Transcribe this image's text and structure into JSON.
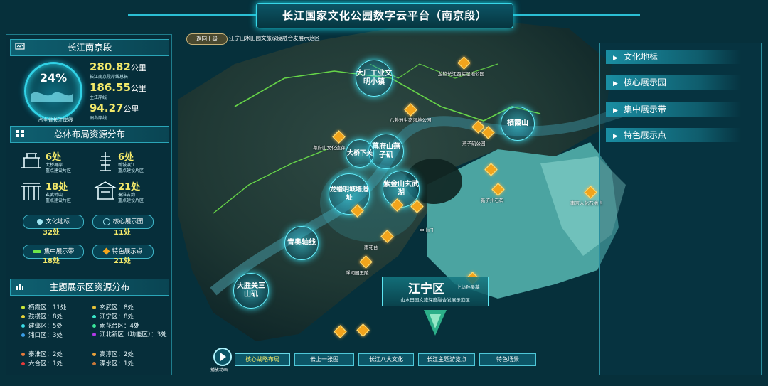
{
  "header": {
    "title": "长江国家文化公园数字云平台（南京段）"
  },
  "breadcrumb": {
    "back_label": "返回上级",
    "path": "江宁山水田园文旅深度融合发展示范区"
  },
  "left_panel": {
    "section1": {
      "title": "长江南京段",
      "ring_percent": "24%",
      "ring_caption": "占全省长江岸线",
      "stats": [
        {
          "value": "280.82",
          "unit": "公里",
          "desc": "长江南京段岸线总长"
        },
        {
          "value": "186.55",
          "unit": "公里",
          "desc": "主江岸线"
        },
        {
          "value": "94.27",
          "unit": "公里",
          "desc": "洲岛岸线"
        }
      ]
    },
    "section2": {
      "title": "总体布局资源分布",
      "items": [
        {
          "value": "6处",
          "desc1": "大桥再岸",
          "desc2": "重点建设片区"
        },
        {
          "value": "6处",
          "desc1": "新城滨江",
          "desc2": "重点建设片区"
        },
        {
          "value": "18处",
          "desc1": "玄武钟山",
          "desc2": "重点建设片区"
        },
        {
          "value": "21处",
          "desc1": "秦淮古韵",
          "desc2": "重点建设片区"
        }
      ],
      "pills": [
        {
          "label": "文化地标",
          "value": "32处"
        },
        {
          "label": "核心展示园",
          "value": "11处"
        },
        {
          "label": "集中展示带",
          "value": "18处"
        },
        {
          "label": "特色展示点",
          "value": "21处"
        }
      ]
    },
    "section3": {
      "title": "主题展示区资源分布",
      "legend_left": [
        {
          "label": "栖霞区：11处",
          "color": "#c9e63a"
        },
        {
          "label": "鼓楼区：8处",
          "color": "#e6d23a"
        },
        {
          "label": "建邺区：5处",
          "color": "#3adbe6"
        },
        {
          "label": "浦口区：3处",
          "color": "#3a9de6"
        },
        {
          "label": "秦淮区：2处",
          "color": "#e67a3a"
        },
        {
          "label": "六合区：1处",
          "color": "#e63a3a"
        }
      ],
      "legend_right": [
        {
          "label": "玄武区：8处",
          "color": "#e6c23a"
        },
        {
          "label": "江宁区：8处",
          "color": "#3ae6c8"
        },
        {
          "label": "雨花台区：4处",
          "color": "#3ae69a"
        },
        {
          "label": "江北新区（功能区）：3处",
          "color": "#b03ae6"
        },
        {
          "label": "高淳区：2处",
          "color": "#e6a03a"
        },
        {
          "label": "溧水区：1处",
          "color": "#c8783a"
        }
      ]
    }
  },
  "right_nav": {
    "items": [
      {
        "label": "文化地标"
      },
      {
        "label": "核心展示园"
      },
      {
        "label": "集中展示带"
      },
      {
        "label": "特色展示点"
      }
    ]
  },
  "map": {
    "bubbles": [
      {
        "label": "大厂工业文明小镇"
      },
      {
        "label": "栖霞山"
      },
      {
        "label": "幕府山燕子矶"
      },
      {
        "label": "大桥下关"
      },
      {
        "label": "紫金山玄武湖"
      },
      {
        "label": "龙蟠明城墙遗址"
      },
      {
        "label": "青奥轴线"
      },
      {
        "label": "大胜关三山矶"
      }
    ],
    "pois": [
      "龙袍长江西猪湿地公园",
      "八卦洲生态湿地公园",
      "燕子矶公园",
      "幕府山文化遗存",
      "新济州石码",
      "南京人化石地点",
      "中山门",
      "雨花台",
      "浮闻园王陵"
    ],
    "district": {
      "name": "江宁区",
      "tag": "上坊孙吴墓",
      "desc": "山水田园文旅深度融合发展示范区"
    }
  },
  "bottom_bar": {
    "play_label": "播放动画",
    "buttons": [
      {
        "label": "核心战略布局",
        "active": true
      },
      {
        "label": "云上一张图",
        "active": false
      },
      {
        "label": "长江八大文化",
        "active": false
      },
      {
        "label": "长江主题游览点",
        "active": false
      },
      {
        "label": "特色场景",
        "active": false
      }
    ]
  },
  "colors": {
    "accent": "#31d2e6",
    "highlight": "#f3e96a",
    "pin": "#f2a41c"
  }
}
